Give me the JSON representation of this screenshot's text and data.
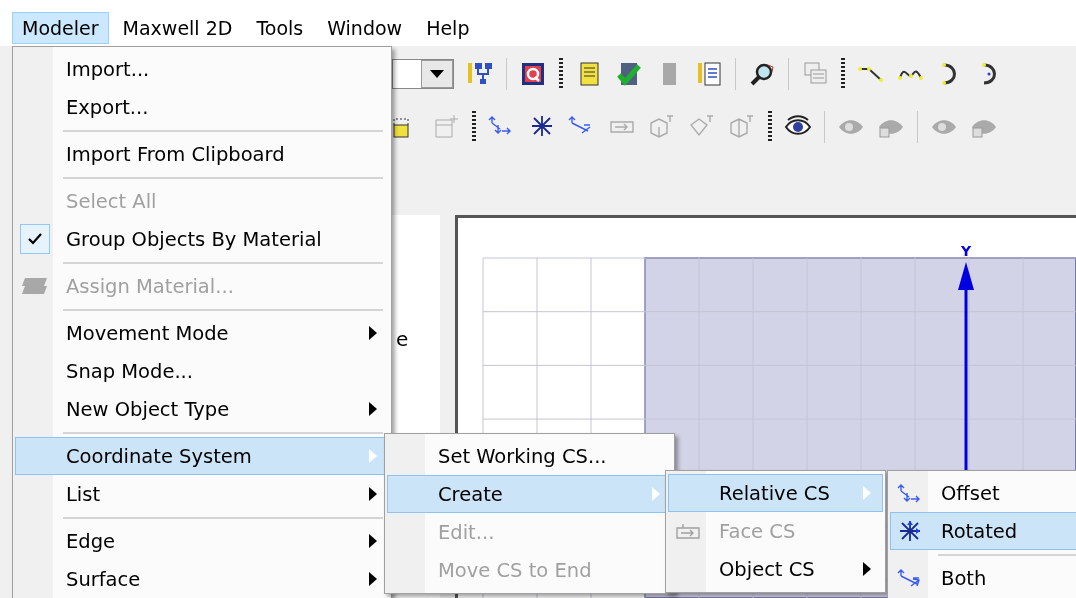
{
  "menubar": [
    {
      "label": "Modeler",
      "selected": true
    },
    {
      "label": "Maxwell 2D",
      "selected": false
    },
    {
      "label": "Tools",
      "selected": false
    },
    {
      "label": "Window",
      "selected": false
    },
    {
      "label": "Help",
      "selected": false
    }
  ],
  "side_panel": {
    "text": "e"
  },
  "canvas": {
    "axis_label": "Y"
  },
  "menus": [
    {
      "items": [
        {
          "kind": "item",
          "label": "Import...",
          "disabled": false,
          "checked": false,
          "selected": false,
          "submenu": false
        },
        {
          "kind": "item",
          "label": "Export...",
          "disabled": false,
          "checked": false,
          "selected": false,
          "submenu": false
        },
        {
          "kind": "separator"
        },
        {
          "kind": "item",
          "label": "Import From Clipboard",
          "disabled": false,
          "checked": false,
          "selected": false,
          "submenu": false
        },
        {
          "kind": "separator"
        },
        {
          "kind": "item",
          "label": "Select All",
          "disabled": true,
          "checked": false,
          "selected": false,
          "submenu": false
        },
        {
          "kind": "item",
          "label": "Group Objects By Material",
          "disabled": false,
          "checked": true,
          "selected": false,
          "submenu": false
        },
        {
          "kind": "separator"
        },
        {
          "kind": "item",
          "label": "Assign Material...",
          "disabled": true,
          "checked": false,
          "selected": false,
          "submenu": false
        },
        {
          "kind": "separator"
        },
        {
          "kind": "item",
          "label": "Movement Mode",
          "disabled": false,
          "checked": false,
          "selected": false,
          "submenu": true
        },
        {
          "kind": "item",
          "label": "Snap Mode...",
          "disabled": false,
          "checked": false,
          "selected": false,
          "submenu": false
        },
        {
          "kind": "item",
          "label": "New Object Type",
          "disabled": false,
          "checked": false,
          "selected": false,
          "submenu": true
        },
        {
          "kind": "separator"
        },
        {
          "kind": "item",
          "label": "Coordinate System",
          "disabled": false,
          "checked": false,
          "selected": true,
          "submenu": true
        },
        {
          "kind": "item",
          "label": "List",
          "disabled": false,
          "checked": false,
          "selected": false,
          "submenu": true
        },
        {
          "kind": "separator"
        },
        {
          "kind": "item",
          "label": "Edge",
          "disabled": false,
          "checked": false,
          "selected": false,
          "submenu": true
        },
        {
          "kind": "item",
          "label": "Surface",
          "disabled": false,
          "checked": false,
          "selected": false,
          "submenu": true
        }
      ]
    },
    {
      "items": [
        {
          "kind": "item",
          "label": "Set Working CS...",
          "disabled": false,
          "checked": false,
          "selected": false,
          "submenu": false
        },
        {
          "kind": "item",
          "label": "Create",
          "disabled": false,
          "checked": false,
          "selected": true,
          "submenu": true
        },
        {
          "kind": "item",
          "label": "Edit...",
          "disabled": true,
          "checked": false,
          "selected": false,
          "submenu": false
        },
        {
          "kind": "item",
          "label": "Move CS to End",
          "disabled": true,
          "checked": false,
          "selected": false,
          "submenu": false
        }
      ]
    },
    {
      "items": [
        {
          "kind": "item",
          "label": "Relative CS",
          "disabled": false,
          "checked": false,
          "selected": true,
          "submenu": true
        },
        {
          "kind": "item",
          "label": "Face CS",
          "disabled": true,
          "checked": false,
          "selected": false,
          "submenu": false
        },
        {
          "kind": "item",
          "label": "Object CS",
          "disabled": false,
          "checked": false,
          "selected": false,
          "submenu": true
        }
      ]
    },
    {
      "items": [
        {
          "kind": "item",
          "label": "Offset",
          "disabled": false,
          "checked": false,
          "selected": false,
          "submenu": false
        },
        {
          "kind": "item",
          "label": "Rotated",
          "disabled": false,
          "checked": false,
          "selected": true,
          "submenu": false
        },
        {
          "kind": "separator"
        },
        {
          "kind": "item",
          "label": "Both",
          "disabled": false,
          "checked": false,
          "selected": false,
          "submenu": false
        }
      ]
    }
  ]
}
